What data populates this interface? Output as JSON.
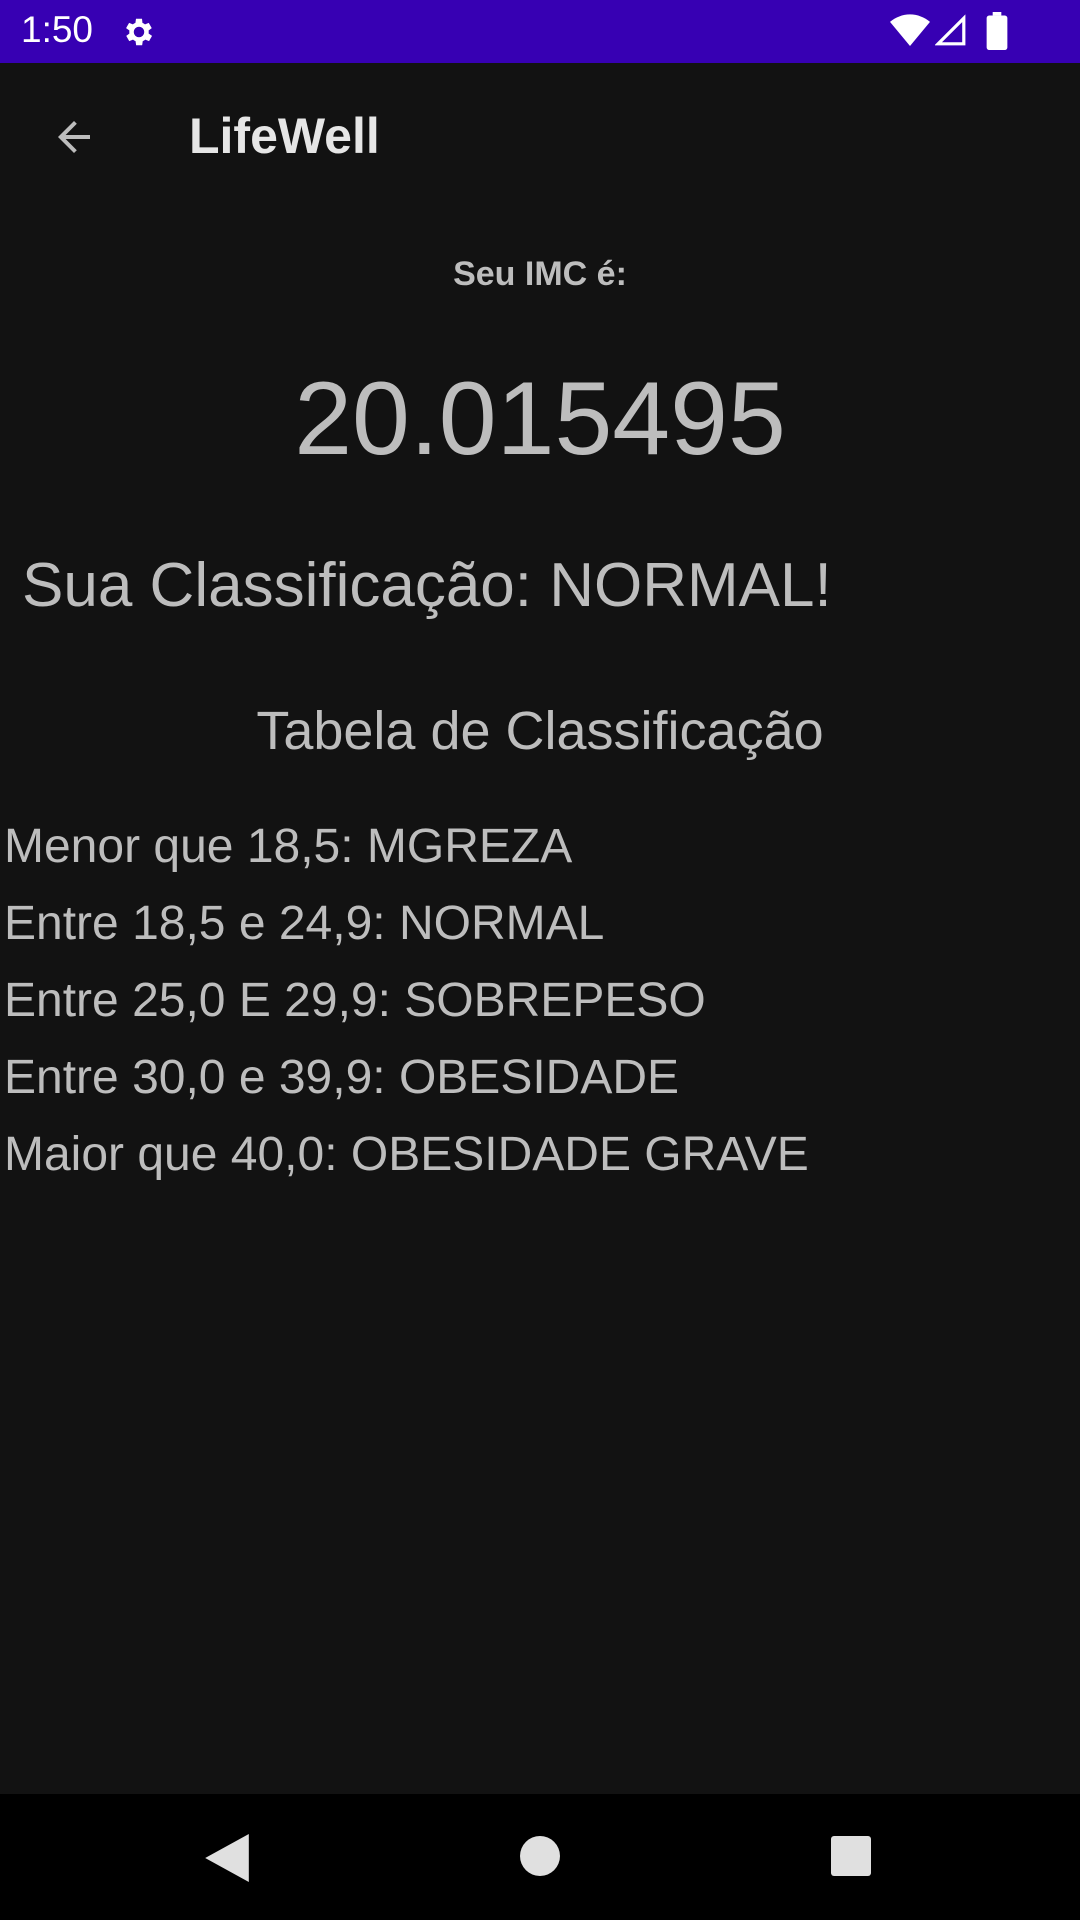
{
  "status_bar": {
    "time": "1:50",
    "icons": [
      "gear-icon",
      "wifi-icon",
      "signal-icon",
      "battery-icon"
    ],
    "background": "#3700B3"
  },
  "app_bar": {
    "title": "LifeWell",
    "back_icon": "arrow-back-icon"
  },
  "result": {
    "label": "Seu IMC é:",
    "value": "20.015495",
    "classification": "Sua Classificação: NORMAL!"
  },
  "table": {
    "title": "Tabela de Classificação",
    "rows": [
      "Menor que 18,5: MGREZA",
      "Entre 18,5 e 24,9: NORMAL",
      "Entre 25,0 E 29,9: SOBREPESO",
      "Entre 30,0 e 39,9: OBESIDADE",
      "Maior que 40,0: OBESIDADE GRAVE"
    ]
  },
  "nav_bar": {
    "icons": [
      "nav-back-icon",
      "nav-home-icon",
      "nav-recents-icon"
    ]
  },
  "colors": {
    "background": "#121212",
    "text": "#bdbdbd",
    "title_text": "#e6e6e6"
  }
}
